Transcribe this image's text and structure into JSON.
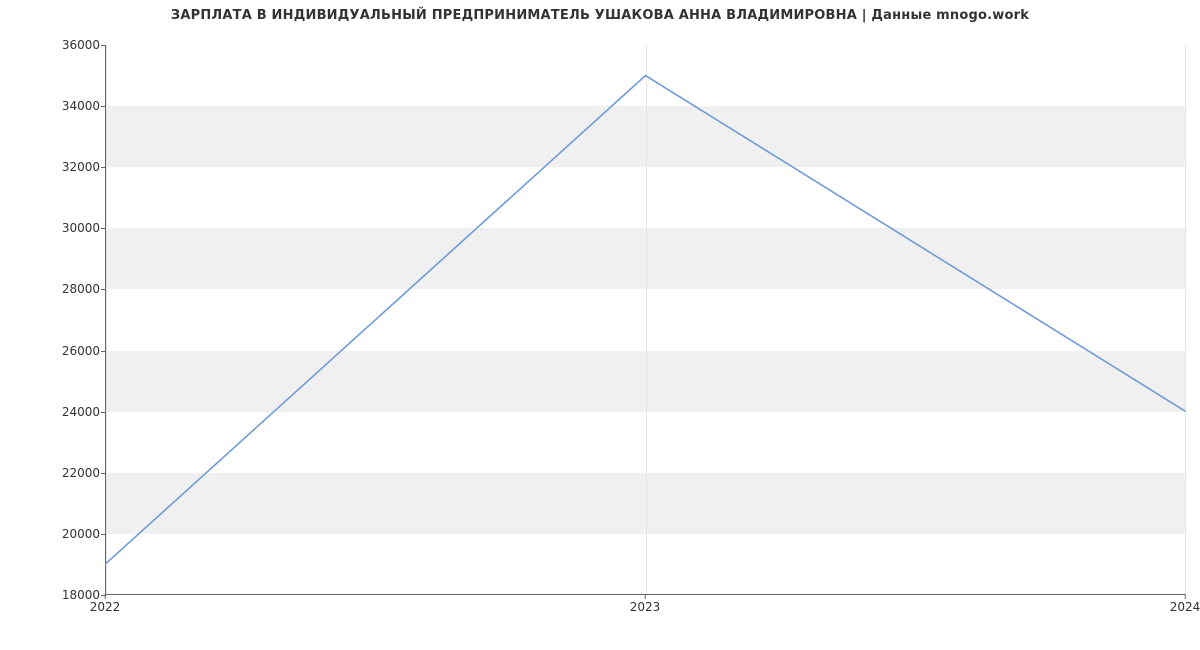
{
  "chart_data": {
    "type": "line",
    "title": "ЗАРПЛАТА В ИНДИВИДУАЛЬНЫЙ ПРЕДПРИНИМАТЕЛЬ УШАКОВА АННА ВЛАДИМИРОВНА | Данные mnogo.work",
    "x": [
      2022,
      2023,
      2024
    ],
    "values": [
      19000,
      35000,
      24000
    ],
    "xlabel": "",
    "ylabel": "",
    "ylim": [
      18000,
      36000
    ],
    "yticks": [
      18000,
      20000,
      22000,
      24000,
      26000,
      28000,
      30000,
      32000,
      34000,
      36000
    ],
    "xticks": [
      2022,
      2023,
      2024
    ],
    "line_color": "#6f9bd8",
    "band_color": "#f0f0f0"
  }
}
